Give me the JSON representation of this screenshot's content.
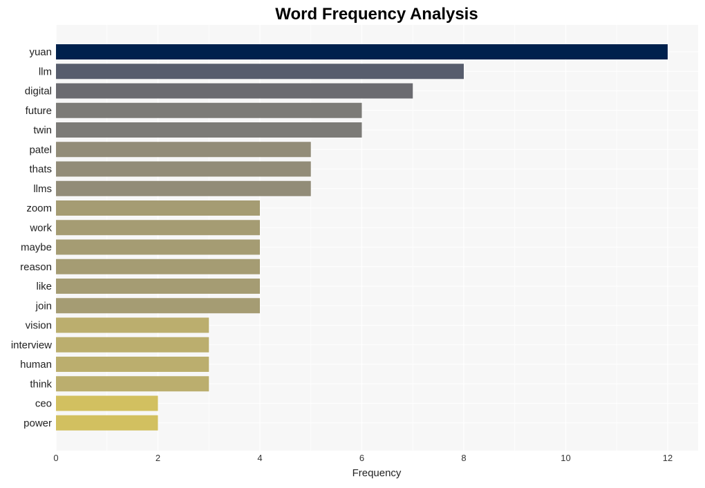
{
  "chart_data": {
    "type": "bar",
    "orientation": "horizontal",
    "title": "Word Frequency Analysis",
    "xlabel": "Frequency",
    "ylabel": "",
    "xlim": [
      0,
      12.6
    ],
    "xticks": [
      0,
      2,
      4,
      6,
      8,
      10,
      12
    ],
    "grid": true,
    "categories": [
      "yuan",
      "llm",
      "digital",
      "future",
      "twin",
      "patel",
      "thats",
      "llms",
      "zoom",
      "work",
      "maybe",
      "reason",
      "like",
      "join",
      "vision",
      "interview",
      "human",
      "think",
      "ceo",
      "power"
    ],
    "values": [
      12,
      8,
      7,
      6,
      6,
      5,
      5,
      5,
      4,
      4,
      4,
      4,
      4,
      4,
      3,
      3,
      3,
      3,
      2,
      2
    ],
    "colors": [
      "#00214d",
      "#575d6d",
      "#6b6b70",
      "#7c7b77",
      "#7c7b77",
      "#928c78",
      "#928c78",
      "#928c78",
      "#a59c73",
      "#a59c73",
      "#a59c73",
      "#a59c73",
      "#a59c73",
      "#a59c73",
      "#bbae6e",
      "#bbae6e",
      "#bbae6e",
      "#bbae6e",
      "#d2c060",
      "#d2c060"
    ]
  }
}
